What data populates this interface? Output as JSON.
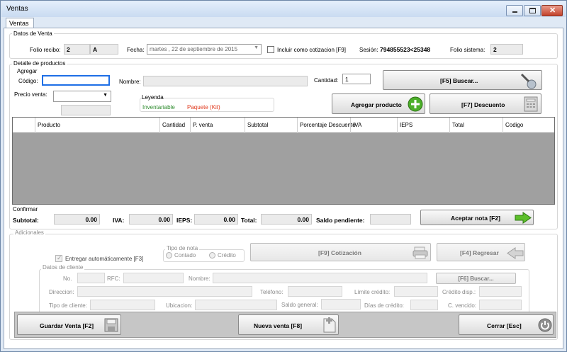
{
  "window": {
    "title": "Ventas"
  },
  "tab": {
    "label": "Ventas"
  },
  "datos_venta": {
    "group_title": "Datos de Venta",
    "folio_recibo_label": "Folio recibo:",
    "folio_recibo_value": "2",
    "folio_recibo_serie": "A",
    "fecha_label": "Fecha:",
    "fecha_value": "martes   , 22 de septiembre de 2015",
    "cotizacion_label": "Incluir como cotizacion [F9]",
    "sesion_label": "Sesión:",
    "sesion_value": "794855523<25348",
    "folio_sistema_label": "Folio sistema:",
    "folio_sistema_value": "2"
  },
  "detalle": {
    "group_title": "Detalle de productos",
    "agregar_title": "Agregar",
    "codigo_label": "Código:",
    "nombre_label": "Nombre:",
    "cantidad_label": "Cantidad:",
    "cantidad_value": "1",
    "buscar_button": "[F5] Buscar...",
    "precio_label": "Precio venta:",
    "leyenda_title": "Leyenda",
    "leyenda_inventariable": "Inventariable",
    "leyenda_paquete": "Paquete (Kit)",
    "agregar_button": "Agregar producto",
    "descuento_button": "[F7] Descuento",
    "columns": [
      "Producto",
      "Cantidad",
      "P. venta",
      "Subtotal",
      "Porcentaje Descuento",
      "IVA",
      "IEPS",
      "Total",
      "Codigo"
    ]
  },
  "confirmar": {
    "group_title": "Confirmar",
    "subtotal_label": "Subtotal:",
    "subtotal_value": "0.00",
    "iva_label": "IVA:",
    "iva_value": "0.00",
    "ieps_label": "IEPS:",
    "ieps_value": "0.00",
    "total_label": "Total:",
    "total_value": "0.00",
    "saldo_label": "Saldo pendiente:",
    "aceptar_button": "Aceptar nota [F2]"
  },
  "adicionales": {
    "group_title": "Adicionales",
    "entregar_label": "Entregar automáticamente [F3]",
    "tipo_nota_title": "Tipo de nota",
    "contado_label": "Contado",
    "credito_label": "Crédito",
    "cotizacion_button": "[F9] Cotización",
    "regresar_button": "[F4] Regresar",
    "datos_cliente_title": "Datos de cliente",
    "no_label": "No.",
    "rfc_label": "RFC:",
    "nombre_label": "Nombre:",
    "buscar_cliente_button": "[F6] Buscar...",
    "direccion_label": "Direccion:",
    "telefono_label": "Teléfono:",
    "limite_label": "Límite crédito:",
    "credito_disp_label": "Crédito disp.:",
    "tipo_cliente_label": "Tipo de cliente:",
    "ubicacion_label": "Ubicacion:",
    "saldo_general_label": "Saldo general:",
    "dias_credito_label": "Días de crédito:",
    "c_vencido_label": "C. vencido:"
  },
  "footer": {
    "guardar_button": "Guardar Venta [F2]",
    "nueva_button": "Nueva venta [F8]",
    "cerrar_button": "Cerrar [Esc]"
  },
  "colors": {
    "inventariable": "#2e8b2e",
    "paquete": "#e0381c",
    "codigo_focus": "#1e6fe6",
    "accent_green": "#4caf2a"
  }
}
